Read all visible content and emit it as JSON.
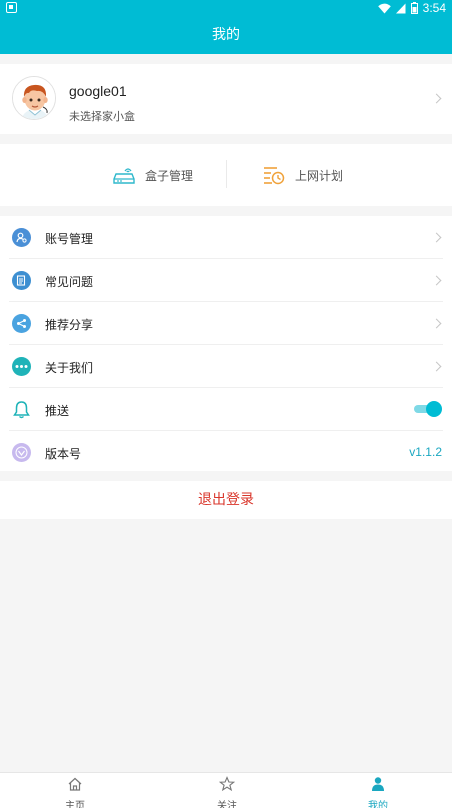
{
  "status_bar": {
    "time": "3:54"
  },
  "header": {
    "title": "我的"
  },
  "profile": {
    "username": "google01",
    "subtitle": "未选择家小盒"
  },
  "quick_actions": [
    {
      "label": "盒子管理",
      "icon": "router-box-icon"
    },
    {
      "label": "上网计划",
      "icon": "schedule-clock-icon"
    }
  ],
  "menu": {
    "account": "账号管理",
    "faq": "常见问题",
    "share": "推荐分享",
    "about": "关于我们",
    "push": "推送",
    "push_enabled": true,
    "version_label": "版本号",
    "version_value": "v1.1.2"
  },
  "logout": "退出登录",
  "tabs": [
    {
      "label": "主页",
      "icon": "home-icon",
      "active": false
    },
    {
      "label": "关注",
      "icon": "star-icon",
      "active": false
    },
    {
      "label": "我的",
      "icon": "person-icon",
      "active": true
    }
  ],
  "colors": {
    "primary": "#00bcd4",
    "logout": "#d9362b",
    "version": "#1aa7c0"
  }
}
